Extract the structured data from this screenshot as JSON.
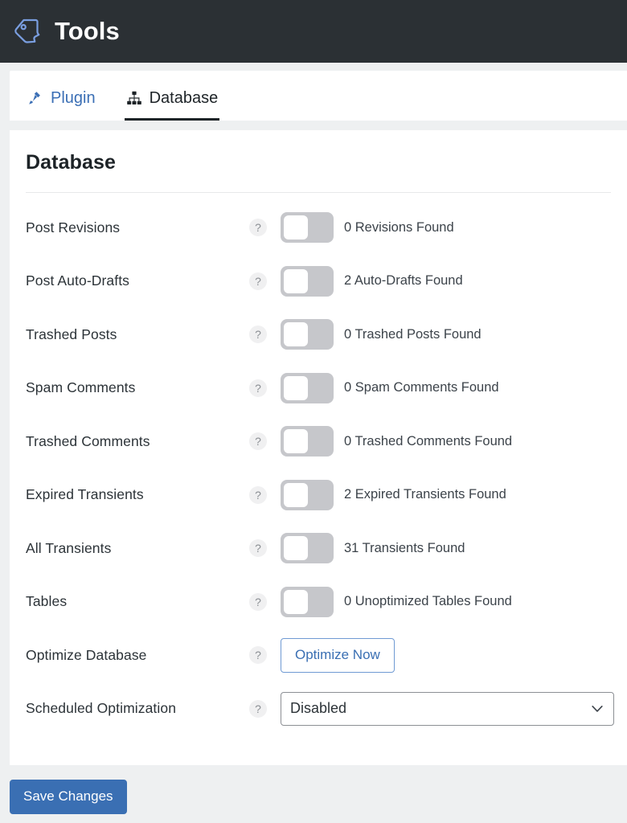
{
  "header": {
    "title": "Tools",
    "logo_icon": "tag-speech-bubble-icon",
    "background_color": "#2b3034"
  },
  "tabs": [
    {
      "label": "Plugin",
      "icon": "plug-icon",
      "active": false,
      "color": "#3b6fb5"
    },
    {
      "label": "Database",
      "icon": "sitemap-icon",
      "active": true,
      "color": "#1d2327"
    }
  ],
  "panel": {
    "title": "Database",
    "help_icon_glyph": "?",
    "rows": [
      {
        "label": "Post Revisions",
        "control": "toggle",
        "toggle_on": false,
        "status": "0 Revisions Found"
      },
      {
        "label": "Post Auto-Drafts",
        "control": "toggle",
        "toggle_on": false,
        "status": "2 Auto-Drafts Found"
      },
      {
        "label": "Trashed Posts",
        "control": "toggle",
        "toggle_on": false,
        "status": "0 Trashed Posts Found"
      },
      {
        "label": "Spam Comments",
        "control": "toggle",
        "toggle_on": false,
        "status": "0 Spam Comments Found"
      },
      {
        "label": "Trashed Comments",
        "control": "toggle",
        "toggle_on": false,
        "status": "0 Trashed Comments Found"
      },
      {
        "label": "Expired Transients",
        "control": "toggle",
        "toggle_on": false,
        "status": "2 Expired Transients Found"
      },
      {
        "label": "All Transients",
        "control": "toggle",
        "toggle_on": false,
        "status": "31 Transients Found"
      },
      {
        "label": "Tables",
        "control": "toggle",
        "toggle_on": false,
        "status": "0 Unoptimized Tables Found"
      }
    ],
    "optimize_row": {
      "label": "Optimize Database",
      "button_label": "Optimize Now"
    },
    "schedule_row": {
      "label": "Scheduled Optimization",
      "selected_option": "Disabled",
      "chevron_icon": "chevron-down-icon"
    }
  },
  "footer": {
    "save_label": "Save Changes",
    "accent_color": "#3a6fb3"
  }
}
